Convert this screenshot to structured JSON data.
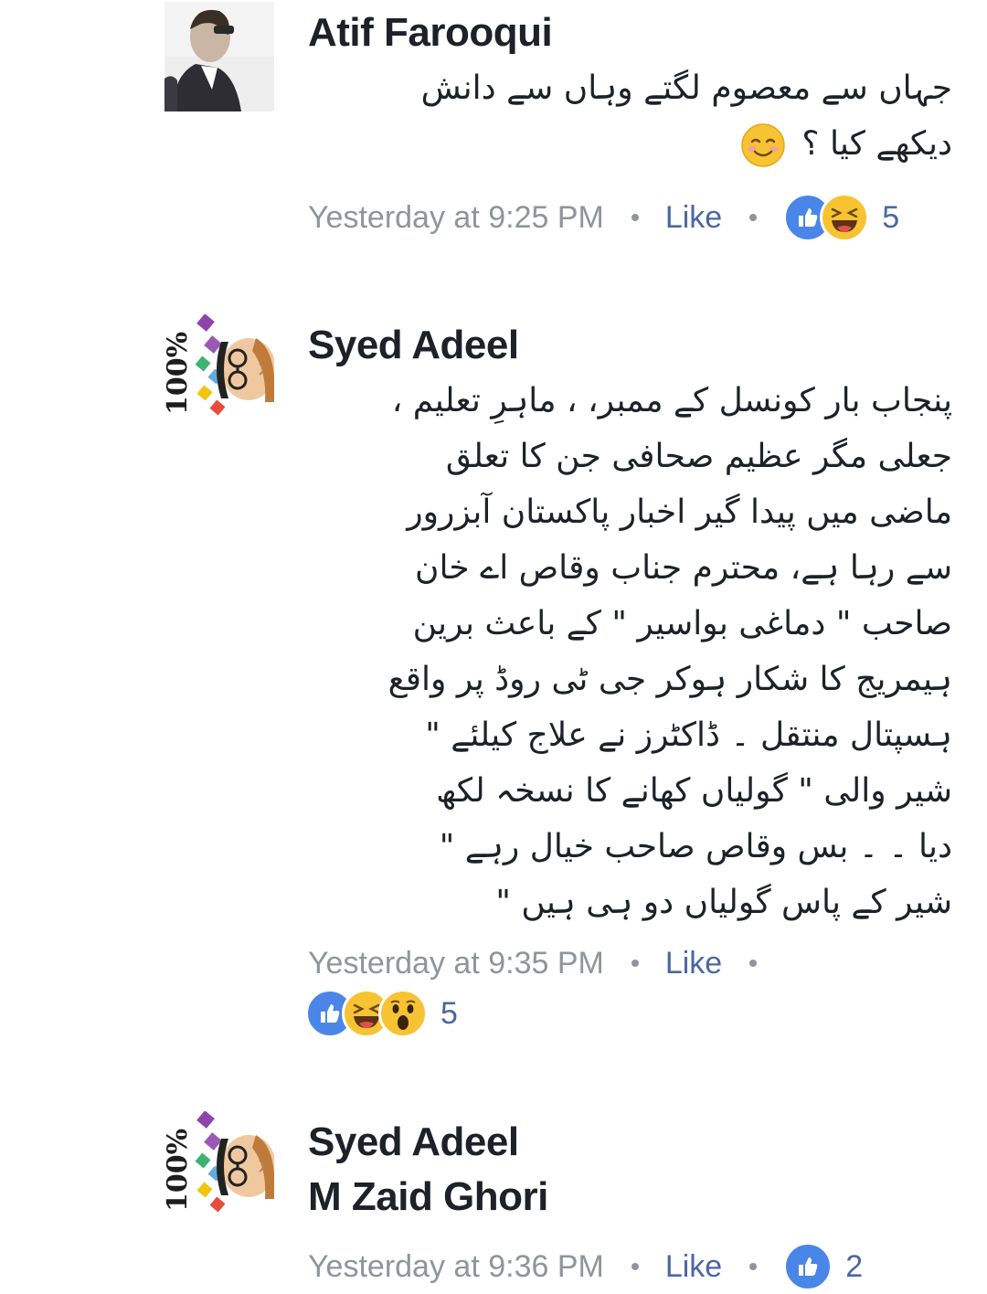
{
  "comments": [
    {
      "author": "Atif Farooqui",
      "text_lines": [
        "جہاں سے معصوم لگتے وہاں سے دانش",
        "دیکھے کیا ؟"
      ],
      "timestamp": "Yesterday at 9:25 PM",
      "like_label": "Like",
      "reaction_count": "5",
      "reactions": [
        "like-icon",
        "haha-icon"
      ]
    },
    {
      "author": "Syed Adeel",
      "text_lines": [
        "پنجاب بار کونسل کے ممبر، ، ماہرِ تعلیم ،",
        "جعلی مگر عظیم صحافی جن کا تعلق",
        "ماضی میں پیدا گیر اخبار پاکستان آبزرور",
        "سے رہا ہے، محترم جناب وقاص اے خان",
        "صاحب \" دماغی بواسیر \" کے باعث برین",
        "ہیمریج کا شکار ہوکر جی ٹی روڈ پر واقع",
        "ہسپتال منتقل ۔ ڈاکٹرز نے علاج کیلئے \"",
        "شیر والی \" گولیاں کھانے کا نسخہ لکھ",
        "دیا ۔ ۔ بس وقاص صاحب خیال رہے \"",
        "شیر کے پاس گولیاں دو ہی ہیں \""
      ],
      "timestamp": "Yesterday at 9:35 PM",
      "like_label": "Like",
      "reaction_count": "5",
      "reactions": [
        "like-icon",
        "haha-icon",
        "wow-icon"
      ]
    },
    {
      "author": "Syed Adeel",
      "mention": "M Zaid Ghori",
      "timestamp": "Yesterday at 9:36 PM",
      "like_label": "Like",
      "reaction_count": "2",
      "reactions": [
        "like-icon"
      ]
    }
  ],
  "avatar_text": "100%",
  "colors": {
    "author": "#1d2129",
    "meta": "#90949c",
    "link": "#4b67a1",
    "like_blue": "#4a86e8",
    "emoji_yellow": "#f8c332"
  }
}
